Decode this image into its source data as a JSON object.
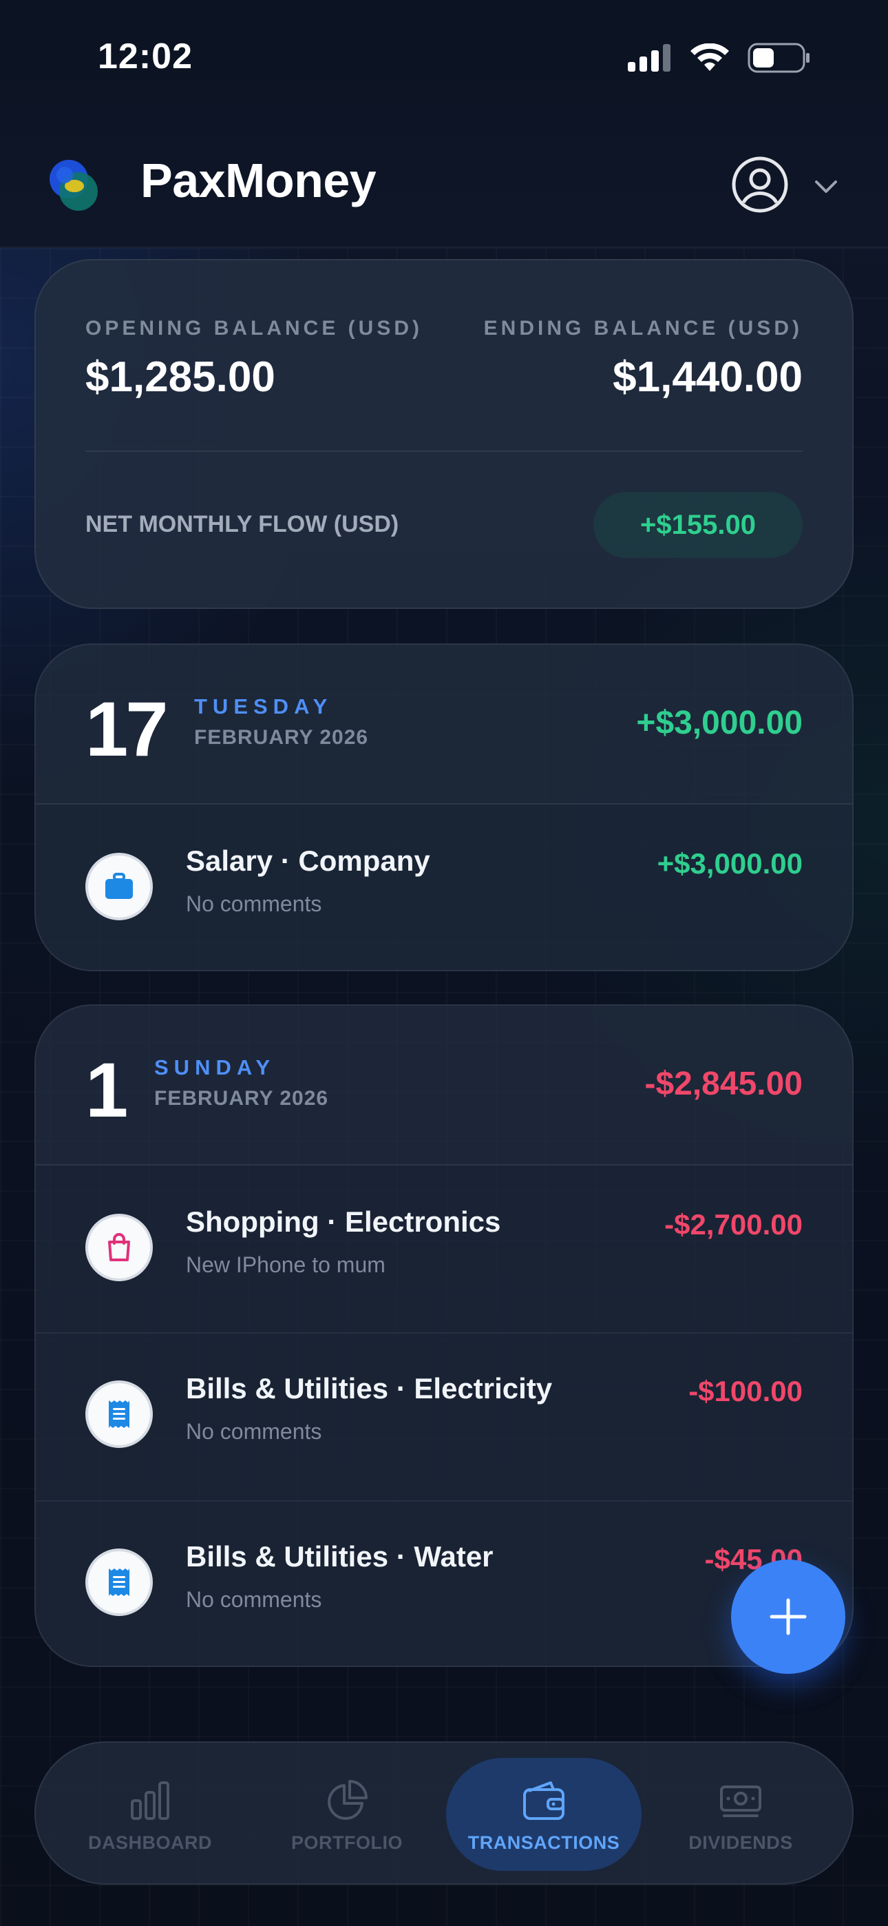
{
  "status_bar": {
    "time": "12:02"
  },
  "header": {
    "app_name": "PaxMoney"
  },
  "balance": {
    "opening_label": "OPENING BALANCE (USD)",
    "opening_value": "$1,285.00",
    "ending_label": "ENDING BALANCE (USD)",
    "ending_value": "$1,440.00",
    "flow_label": "NET MONTHLY FLOW (USD)",
    "flow_value": "+$155.00"
  },
  "groups": [
    {
      "day": "17",
      "weekday": "TUESDAY",
      "month": "FEBRUARY 2026",
      "total": "+$3,000.00",
      "transactions": [
        {
          "title": "Salary · Company",
          "comment": "No comments",
          "amount": "+$3,000.00",
          "icon": "briefcase-icon"
        }
      ]
    },
    {
      "day": "1",
      "weekday": "SUNDAY",
      "month": "FEBRUARY 2026",
      "total": "-$2,845.00",
      "transactions": [
        {
          "title": "Shopping · Electronics",
          "comment": "New IPhone to mum",
          "amount": "-$2,700.00",
          "icon": "shopping-bag-icon"
        },
        {
          "title": "Bills & Utilities · Electricity",
          "comment": "No comments",
          "amount": "-$100.00",
          "icon": "receipt-icon"
        },
        {
          "title": "Bills & Utilities · Water",
          "comment": "No comments",
          "amount": "-$45.00",
          "icon": "receipt-icon"
        }
      ]
    }
  ],
  "nav": {
    "items": [
      {
        "label": "DASHBOARD",
        "icon": "bar-chart-icon"
      },
      {
        "label": "PORTFOLIO",
        "icon": "pie-chart-icon"
      },
      {
        "label": "TRANSACTIONS",
        "icon": "wallet-icon",
        "active": true
      },
      {
        "label": "DIVIDENDS",
        "icon": "banknote-icon"
      }
    ]
  },
  "colors": {
    "accent": "#3b82f6",
    "positive": "#2fcf8f",
    "negative": "#f0476a",
    "weekday": "#4f8ff7"
  }
}
